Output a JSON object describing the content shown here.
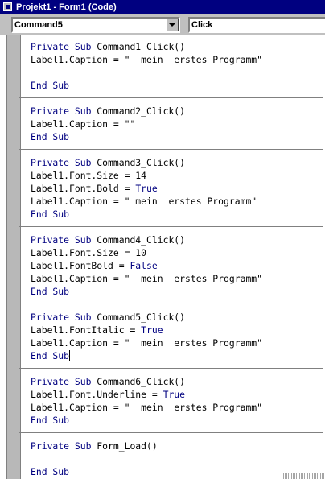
{
  "window": {
    "title": "Projekt1 - Form1 (Code)"
  },
  "toolbar": {
    "object_combo": "Command5",
    "procedure_combo": "Click"
  },
  "procedures": [
    {
      "lines": [
        [
          {
            "t": "Private Sub ",
            "k": true
          },
          {
            "t": "Command1_Click()",
            "k": false
          }
        ],
        [
          {
            "t": "Label1.Caption = \"  mein  erstes Programm\"",
            "k": false
          }
        ],
        [],
        [
          {
            "t": "End Sub",
            "k": true
          }
        ]
      ]
    },
    {
      "lines": [
        [
          {
            "t": "Private Sub ",
            "k": true
          },
          {
            "t": "Command2_Click()",
            "k": false
          }
        ],
        [
          {
            "t": "Label1.Caption = \"\"",
            "k": false
          }
        ],
        [
          {
            "t": "End Sub",
            "k": true
          }
        ]
      ]
    },
    {
      "lines": [
        [
          {
            "t": "Private Sub ",
            "k": true
          },
          {
            "t": "Command3_Click()",
            "k": false
          }
        ],
        [
          {
            "t": "Label1.Font.Size = 14",
            "k": false
          }
        ],
        [
          {
            "t": "Label1.Font.Bold = ",
            "k": false
          },
          {
            "t": "True",
            "k": true
          }
        ],
        [
          {
            "t": "Label1.Caption = \" mein  erstes Programm\"",
            "k": false
          }
        ],
        [
          {
            "t": "End Sub",
            "k": true
          }
        ]
      ]
    },
    {
      "lines": [
        [
          {
            "t": "Private Sub ",
            "k": true
          },
          {
            "t": "Command4_Click()",
            "k": false
          }
        ],
        [
          {
            "t": "Label1.Font.Size = 10",
            "k": false
          }
        ],
        [
          {
            "t": "Label1.FontBold = ",
            "k": false
          },
          {
            "t": "False",
            "k": true
          }
        ],
        [
          {
            "t": "Label1.Caption = \"  mein  erstes Programm\"",
            "k": false
          }
        ],
        [
          {
            "t": "End Sub",
            "k": true
          }
        ]
      ]
    },
    {
      "lines": [
        [
          {
            "t": "Private Sub ",
            "k": true
          },
          {
            "t": "Command5_Click()",
            "k": false
          }
        ],
        [
          {
            "t": "Label1.FontItalic = ",
            "k": false
          },
          {
            "t": "True",
            "k": true
          }
        ],
        [
          {
            "t": "Label1.Caption = \"  mein  erstes Programm\"",
            "k": false
          }
        ],
        [
          {
            "t": "End Sub",
            "k": true
          }
        ]
      ]
    },
    {
      "lines": [
        [
          {
            "t": "Private Sub ",
            "k": true
          },
          {
            "t": "Command6_Click()",
            "k": false
          }
        ],
        [
          {
            "t": "Label1.Font.Underline = ",
            "k": false
          },
          {
            "t": "True",
            "k": true
          }
        ],
        [
          {
            "t": "Label1.Caption = \"  mein  erstes Programm\"",
            "k": false
          }
        ],
        [
          {
            "t": "End Sub",
            "k": true
          }
        ]
      ]
    },
    {
      "lines": [
        [
          {
            "t": "Private Sub ",
            "k": true
          },
          {
            "t": "Form_Load()",
            "k": false
          }
        ],
        [],
        [
          {
            "t": "End Sub",
            "k": true
          }
        ]
      ]
    }
  ],
  "cursor": {
    "procedure": 4,
    "line": 3
  },
  "colors": {
    "keyword": "#000080",
    "titlebar": "#000080",
    "gutter": "#b8b8b8"
  },
  "icons": {
    "title": "vb-code-window-icon",
    "dropdown": "chevron-down-icon"
  }
}
